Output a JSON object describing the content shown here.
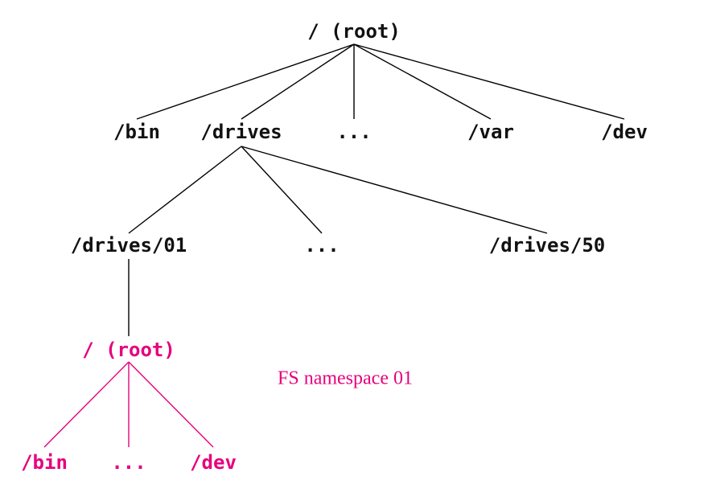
{
  "diagram": {
    "root": {
      "label": "/ (root)"
    },
    "bin": {
      "label": "/bin"
    },
    "drives": {
      "label": "/drives"
    },
    "ell1": {
      "label": "..."
    },
    "var": {
      "label": "/var"
    },
    "dev": {
      "label": "/dev"
    },
    "drives01": {
      "label": "/drives/01"
    },
    "ell2": {
      "label": "..."
    },
    "drives50": {
      "label": "/drives/50"
    },
    "ns_root": {
      "label": "/ (root)"
    },
    "ns_bin": {
      "label": "/bin"
    },
    "ns_ell": {
      "label": "..."
    },
    "ns_dev": {
      "label": "/dev"
    },
    "annotation": {
      "label": "FS namespace 01"
    }
  }
}
